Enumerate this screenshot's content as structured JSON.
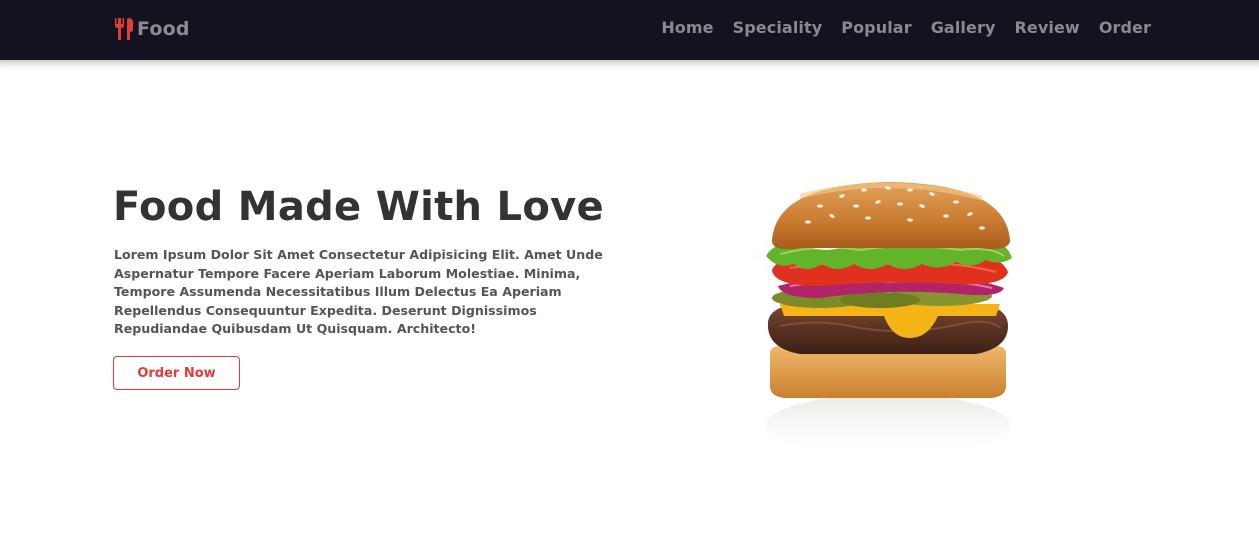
{
  "header": {
    "logo_text": "Food",
    "nav": [
      "Home",
      "Speciality",
      "Popular",
      "Gallery",
      "Review",
      "Order"
    ]
  },
  "hero": {
    "title": "Food Made With Love",
    "description": "Lorem Ipsum Dolor Sit Amet Consectetur Adipisicing Elit. Amet Unde Aspernatur Tempore Facere Aperiam Laborum Molestiae. Minima, Tempore Assumenda Necessitatibus Illum Delectus Ea Aperiam Repellendus Consequuntur Expedita. Deserunt Dignissimos Repudiandae Quibusdam Ut Quisquam. Architecto!",
    "button_label": "Order Now",
    "image_icon": "burger-image"
  },
  "colors": {
    "navbar": "#13121e",
    "accent": "#e63b3b",
    "nav_text": "#8a8991",
    "heading": "#333333"
  }
}
